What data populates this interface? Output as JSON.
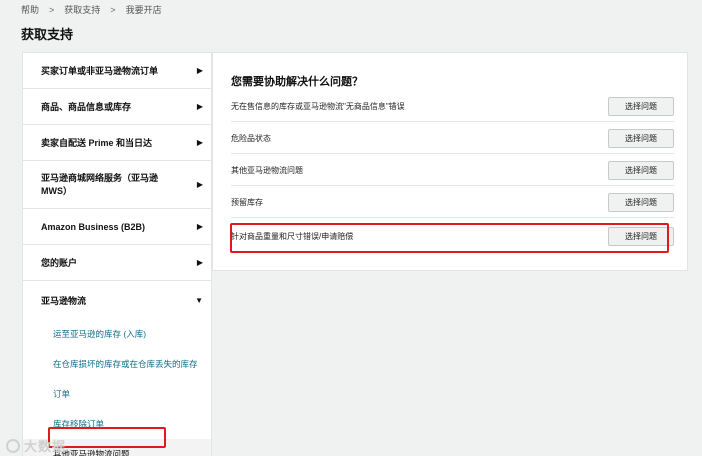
{
  "breadcrumb": {
    "items": [
      "帮助",
      "获取支持",
      "我要开店"
    ]
  },
  "page_title": "获取支持",
  "sidebar": {
    "items": [
      {
        "label": "买家订单或非亚马逊物流订单"
      },
      {
        "label": "商品、商品信息或库存"
      },
      {
        "label": "卖家自配送 Prime 和当日达"
      },
      {
        "label": "亚马逊商城网络服务（亚马逊 MWS）"
      },
      {
        "label": "Amazon Business (B2B)"
      },
      {
        "label": "您的账户"
      },
      {
        "label": "亚马逊物流"
      }
    ],
    "subitems": [
      {
        "label": "运至亚马逊的库存 (入库)"
      },
      {
        "label": "在仓库损坏的库存或在仓库丢失的库存"
      },
      {
        "label": "订单"
      },
      {
        "label": "库存移除订单"
      },
      {
        "label": "其他亚马逊物流问题"
      }
    ]
  },
  "panel": {
    "heading": "您需要协助解决什么问题？",
    "issues": [
      {
        "label": "无在售信息的库存或亚马逊物流\"无商品信息\"错误",
        "button": "选择问题"
      },
      {
        "label": "危险品状态",
        "button": "选择问题"
      },
      {
        "label": "其他亚马逊物流问题",
        "button": "选择问题"
      },
      {
        "label": "预留库存",
        "button": "选择问题"
      },
      {
        "label": "针对商品重量和尺寸错误/申请赔偿",
        "button": "选择问题"
      }
    ]
  },
  "watermark": "大数据"
}
